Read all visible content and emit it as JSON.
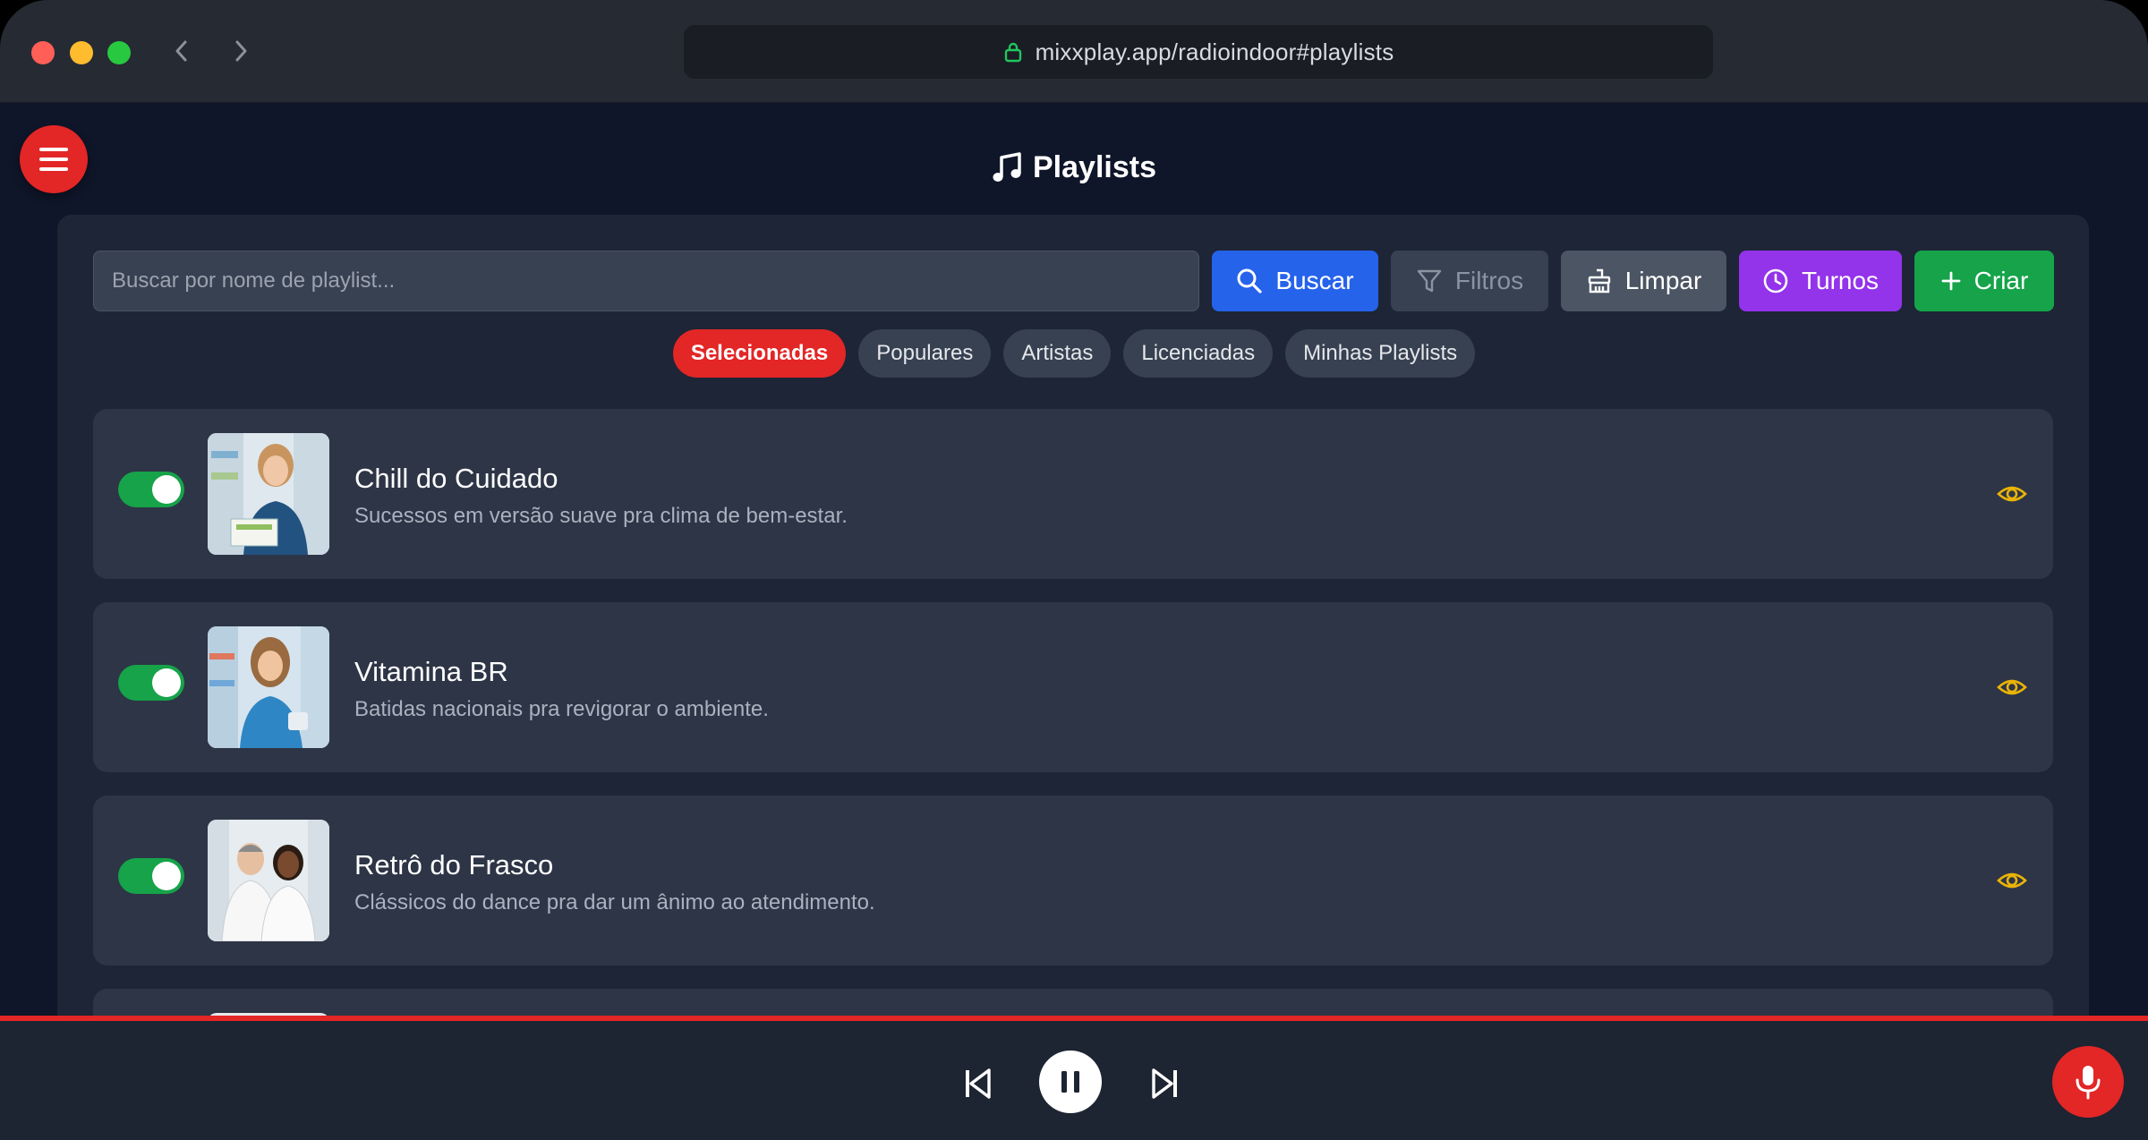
{
  "browser": {
    "url": "mixxplay.app/radioindoor#playlists"
  },
  "page": {
    "title": "Playlists"
  },
  "search": {
    "placeholder": "Buscar por nome de playlist...",
    "value": ""
  },
  "toolbar": {
    "buscar_label": "Buscar",
    "filtros_label": "Filtros",
    "limpar_label": "Limpar",
    "turnos_label": "Turnos",
    "criar_label": "Criar"
  },
  "tabs": [
    {
      "label": "Selecionadas",
      "active": true
    },
    {
      "label": "Populares",
      "active": false
    },
    {
      "label": "Artistas",
      "active": false
    },
    {
      "label": "Licenciadas",
      "active": false
    },
    {
      "label": "Minhas Playlists",
      "active": false
    }
  ],
  "playlists": [
    {
      "title": "Chill do Cuidado",
      "description": "Sucessos em versão suave pra clima de bem-estar.",
      "enabled": true
    },
    {
      "title": "Vitamina BR",
      "description": "Batidas nacionais pra revigorar o ambiente.",
      "enabled": true
    },
    {
      "title": "Retrô do Frasco",
      "description": "Clássicos do dance pra dar um ânimo ao atendimento.",
      "enabled": true
    }
  ],
  "colors": {
    "accent_red": "#e32626",
    "buscar_blue": "#2563eb",
    "turnos_purple": "#9333ea",
    "criar_green": "#16a34a",
    "eye_yellow": "#eab308"
  },
  "icons": {
    "menu": "hamburger-icon",
    "title": "music-note-icon",
    "buscar": "search-icon",
    "filtros": "funnel-icon",
    "limpar": "broom-icon",
    "turnos": "clock-icon",
    "criar": "plus-icon",
    "playlist_action": "eye-icon",
    "player_prev": "skip-back-icon",
    "player_pause": "pause-icon",
    "player_next": "skip-forward-icon",
    "mic": "microphone-icon"
  }
}
